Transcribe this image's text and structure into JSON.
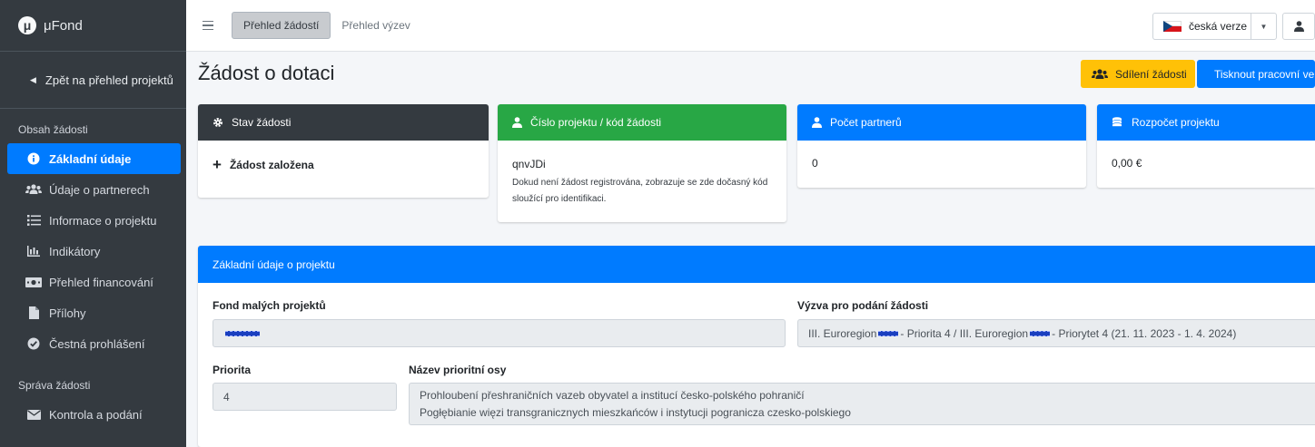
{
  "brand": {
    "logo_letter": "μ",
    "name": "μFond"
  },
  "sidebar": {
    "back_label": "Zpět na přehled projektů",
    "sections": [
      {
        "title": "Obsah žádosti",
        "items": [
          {
            "label": "Základní údaje",
            "icon": "info-circle-icon",
            "active": true
          },
          {
            "label": "Údaje o partnerech",
            "icon": "users-icon"
          },
          {
            "label": "Informace o projektu",
            "icon": "list-icon"
          },
          {
            "label": "Indikátory",
            "icon": "bar-chart-icon"
          },
          {
            "label": "Přehled financování",
            "icon": "money-bill-icon"
          },
          {
            "label": "Přílohy",
            "icon": "file-icon"
          },
          {
            "label": "Čestná prohlášení",
            "icon": "check-circle-icon"
          }
        ]
      },
      {
        "title": "Správa žádosti",
        "items": [
          {
            "label": "Kontrola a podání",
            "icon": "envelope-icon"
          }
        ]
      }
    ]
  },
  "topbar": {
    "tabs": [
      {
        "label": "Přehled žádostí",
        "active": true
      },
      {
        "label": "Přehled výzev",
        "active": false
      }
    ],
    "language": "česká verze"
  },
  "page": {
    "title": "Žádost o dotaci",
    "share_button": "Sdílení žádosti",
    "print_button": "Tisknout pracovní verzi"
  },
  "cards": {
    "status": {
      "title": "Stav žádosti",
      "value": "Žádost založena"
    },
    "project_number": {
      "title": "Číslo projektu / kód žádosti",
      "value": "qnvJDi",
      "note": "Dokud není žádost registrována, zobrazuje se zde dočasný kód sloužící pro identifikaci."
    },
    "partners": {
      "title": "Počet partnerů",
      "value": "0"
    },
    "budget": {
      "title": "Rozpočet projektu",
      "value": "0,00 €"
    }
  },
  "basic_info": {
    "title": "Základní údaje o projektu",
    "fund_label": "Fond malých projektů",
    "call_label": "Výzva pro podání žádosti",
    "call_value_part1": "III. Euroregion",
    "call_value_part2": "- Priorita 4  / III. Euroregion",
    "call_value_part3": "- Priorytet 4 (21. 11. 2023 - 1. 4. 2024)",
    "priority_label": "Priorita",
    "priority_value": "4",
    "axis_label": "Název prioritní osy",
    "axis_value_cz": "Prohloubení přeshraničních vazeb obyvatel a institucí česko-polského pohraničí",
    "axis_value_pl": "Pogłębianie więzi transgranicznych mieszkańców i instytucji pogranicza czesko-polskiego"
  },
  "colors": {
    "primary": "#007bff",
    "success": "#28a745",
    "warning": "#ffc107",
    "dark": "#343a40"
  }
}
